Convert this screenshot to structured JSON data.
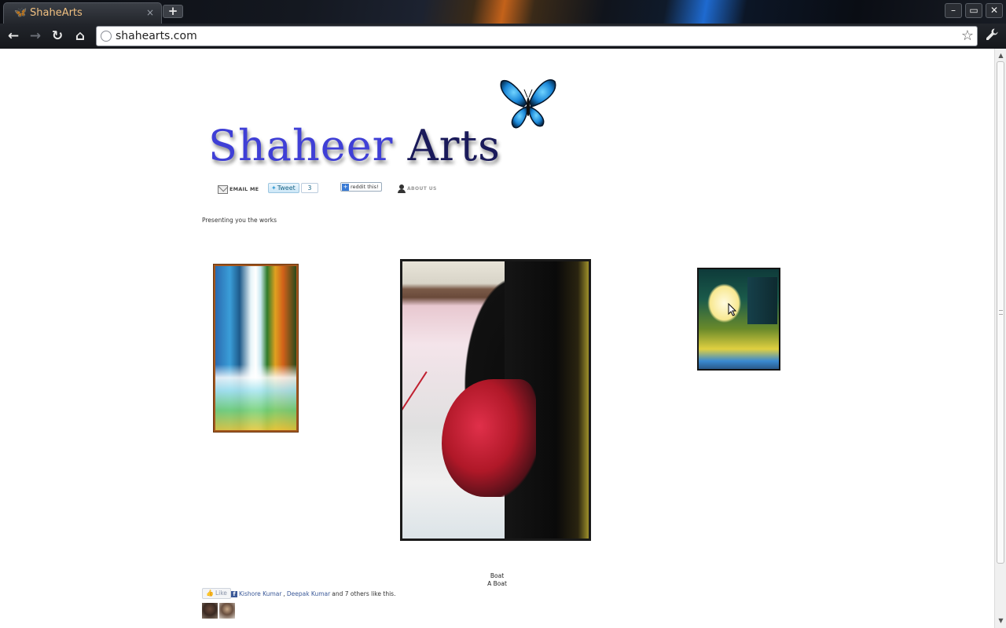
{
  "browser": {
    "tab_title": "ShaheArts",
    "tab_close": "×",
    "new_tab": "+",
    "url": "shahearts.com",
    "window_controls": {
      "minimize": "–",
      "maximize": "▭",
      "close": "✕"
    },
    "nav_icons": {
      "back": "←",
      "forward": "→",
      "reload": "↻",
      "home": "⌂",
      "bookmark": "☆",
      "menu": "🔧"
    }
  },
  "site": {
    "title_part1": "Shaheer ",
    "title_part2": "Arts",
    "nav": {
      "email_label": "EMAIL ME",
      "tweet_label": "Tweet",
      "tweet_count": "3",
      "reddit_label": "reddit this!",
      "about_label": "ABOUT US"
    },
    "intro": "Presenting you the works",
    "caption_title": "Boat",
    "caption_subtitle": "A Boat",
    "like": {
      "button_label": "Like",
      "friend1": "Kishore Kumar",
      "separator": ",",
      "friend2": "Deepak Kumar",
      "others_text": "and 7 others like this."
    }
  },
  "colors": {
    "title_blue": "#3f3fd6",
    "facebook_blue": "#3b5998",
    "tab_title_orange": "#f0c080"
  }
}
